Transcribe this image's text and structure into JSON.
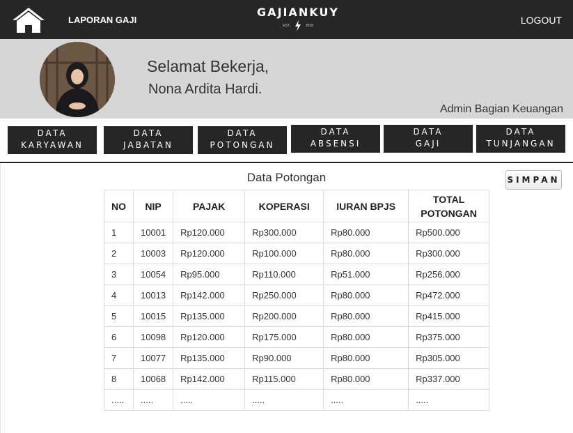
{
  "header": {
    "nav_label": "LAPORAN GAJI",
    "brand_name": "GAJIANKUY",
    "brand_est": "EST.",
    "brand_year": "2019",
    "logout_label": "LOGOUT"
  },
  "banner": {
    "greeting": "Selamat Bekerja,",
    "name": "Nona Ardita Hardi.",
    "role": "Admin Bagian Keuangan"
  },
  "menu": [
    {
      "line1": "DATA",
      "line2": "KARYAWAN"
    },
    {
      "line1": "DATA",
      "line2": "JABATAN"
    },
    {
      "line1": "DATA",
      "line2": "POTONGAN"
    },
    {
      "line1": "DATA",
      "line2": "ABSENSI"
    },
    {
      "line1": "DATA",
      "line2": "GAJI"
    },
    {
      "line1": "DATA",
      "line2": "TUNJANGAN"
    }
  ],
  "content": {
    "title": "Data Potongan",
    "save_label": "SIMPAN"
  },
  "table": {
    "headers": [
      "NO",
      "NIP",
      "PAJAK",
      "KOPERASI",
      "IURAN BPJS",
      "TOTAL POTONGAN"
    ],
    "rows": [
      [
        "1",
        "10001",
        "Rp120.000",
        "Rp300.000",
        "Rp80.000",
        "Rp500.000"
      ],
      [
        "2",
        "10003",
        "Rp120.000",
        "Rp100.000",
        "Rp80.000",
        "Rp300.000"
      ],
      [
        "3",
        "10054",
        "Rp95.000",
        "Rp110.000",
        "Rp51.000",
        "Rp256.000"
      ],
      [
        "4",
        "10013",
        "Rp142.000",
        "Rp250.000",
        "Rp80.000",
        "Rp472.000"
      ],
      [
        "5",
        "10015",
        "Rp135.000",
        "Rp200.000",
        "Rp80.000",
        "Rp415.000"
      ],
      [
        "6",
        "10098",
        "Rp120.000",
        "Rp175.000",
        "Rp80.000",
        "Rp375.000"
      ],
      [
        "7",
        "10077",
        "Rp135.000",
        "Rp90.000",
        "Rp80.000",
        "Rp305.000"
      ],
      [
        "8",
        "10068",
        "Rp142.000",
        "Rp115.000",
        "Rp80.000",
        "Rp337.000"
      ],
      [
        ".....",
        ".....",
        ".....",
        ".....",
        ".....",
        "....."
      ]
    ]
  },
  "colors": {
    "bar": "#262626",
    "banner": "#d6d6d6"
  }
}
